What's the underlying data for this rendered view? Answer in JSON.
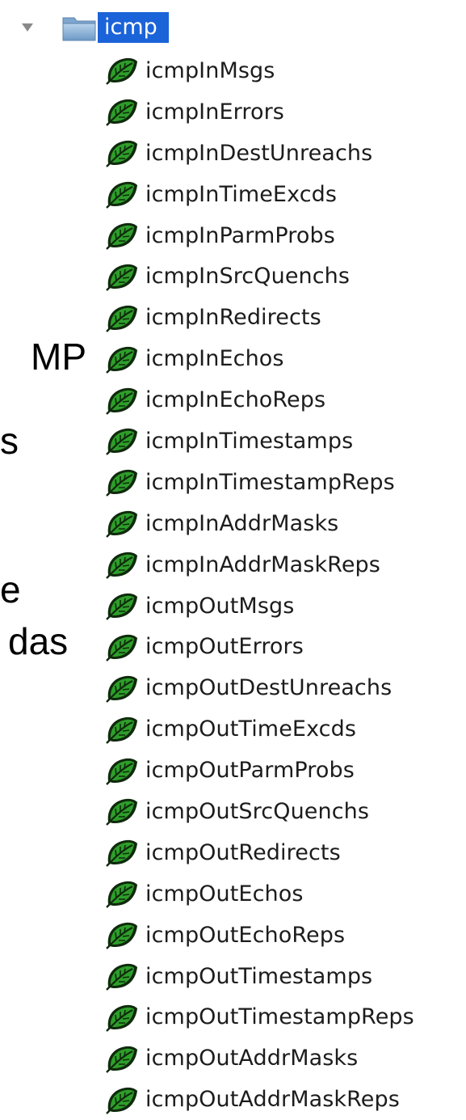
{
  "background_text": [
    "MP",
    "s",
    "e",
    "das"
  ],
  "tree": {
    "root": {
      "label": "icmp",
      "expanded": true,
      "icon": "folder-icon"
    },
    "leaf_icon": "leaf-icon",
    "leaves": [
      {
        "label": "icmpInMsgs"
      },
      {
        "label": "icmpInErrors"
      },
      {
        "label": "icmpInDestUnreachs"
      },
      {
        "label": "icmpInTimeExcds"
      },
      {
        "label": "icmpInParmProbs"
      },
      {
        "label": "icmpInSrcQuenchs"
      },
      {
        "label": "icmpInRedirects"
      },
      {
        "label": "icmpInEchos"
      },
      {
        "label": "icmpInEchoReps"
      },
      {
        "label": "icmpInTimestamps"
      },
      {
        "label": "icmpInTimestampReps"
      },
      {
        "label": "icmpInAddrMasks"
      },
      {
        "label": "icmpInAddrMaskReps"
      },
      {
        "label": "icmpOutMsgs"
      },
      {
        "label": "icmpOutErrors"
      },
      {
        "label": "icmpOutDestUnreachs"
      },
      {
        "label": "icmpOutTimeExcds"
      },
      {
        "label": "icmpOutParmProbs"
      },
      {
        "label": "icmpOutSrcQuenchs"
      },
      {
        "label": "icmpOutRedirects"
      },
      {
        "label": "icmpOutEchos"
      },
      {
        "label": "icmpOutEchoReps"
      },
      {
        "label": "icmpOutTimestamps"
      },
      {
        "label": "icmpOutTimestampReps"
      },
      {
        "label": "icmpOutAddrMasks"
      },
      {
        "label": "icmpOutAddrMaskReps"
      }
    ]
  },
  "colors": {
    "selection": "#1b63d8",
    "leaf_green": "#2e9e2a",
    "leaf_dark": "#0f2a0c"
  }
}
